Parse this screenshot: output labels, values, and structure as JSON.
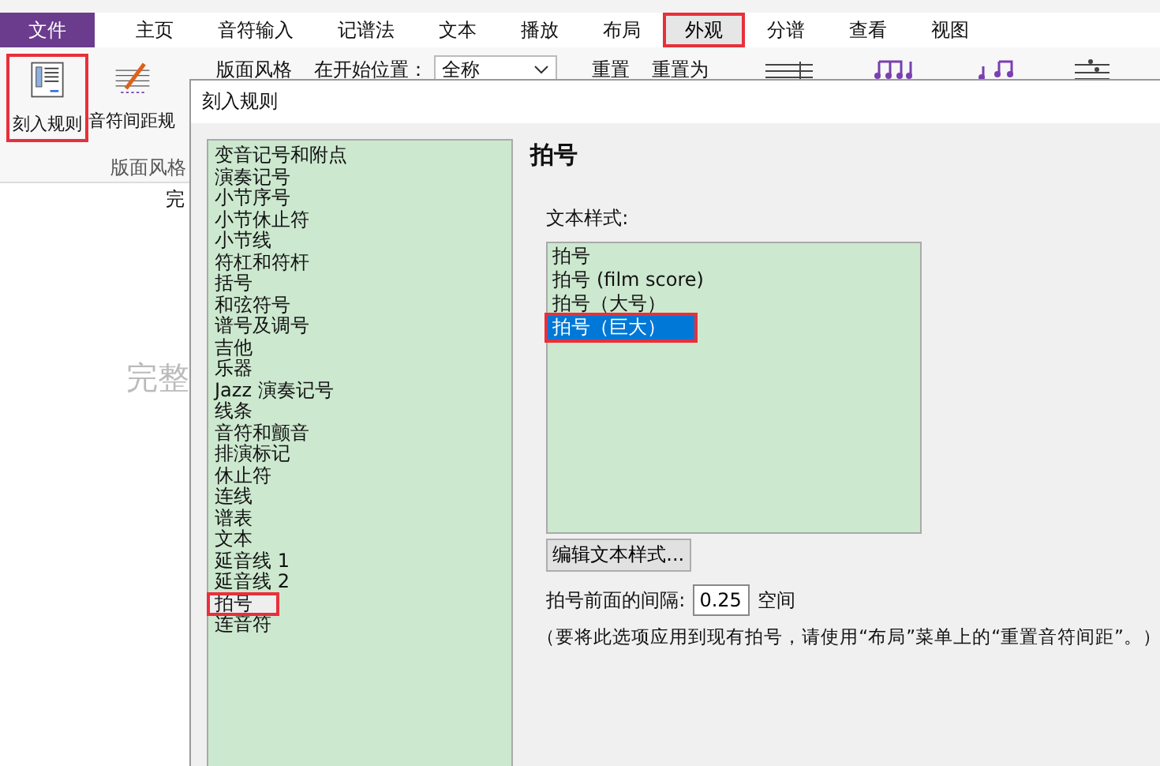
{
  "menu_tabs": [
    {
      "label": "文件",
      "kind": "file",
      "selected": false,
      "highlighted": false
    },
    {
      "label": "主页",
      "kind": "tab",
      "selected": false,
      "highlighted": false
    },
    {
      "label": "音符输入",
      "kind": "tab",
      "selected": false,
      "highlighted": false
    },
    {
      "label": "记谱法",
      "kind": "tab",
      "selected": false,
      "highlighted": false
    },
    {
      "label": "文本",
      "kind": "tab",
      "selected": false,
      "highlighted": false
    },
    {
      "label": "播放",
      "kind": "tab",
      "selected": false,
      "highlighted": false
    },
    {
      "label": "布局",
      "kind": "tab",
      "selected": false,
      "highlighted": false
    },
    {
      "label": "外观",
      "kind": "tab",
      "selected": true,
      "highlighted": true
    },
    {
      "label": "分谱",
      "kind": "tab",
      "selected": false,
      "highlighted": false
    },
    {
      "label": "查看",
      "kind": "tab",
      "selected": false,
      "highlighted": false
    },
    {
      "label": "视图",
      "kind": "tab",
      "selected": false,
      "highlighted": false
    }
  ],
  "ribbon": {
    "buttons": [
      {
        "label": "刻入规则",
        "highlighted": true
      },
      {
        "label": "音符间距规",
        "highlighted": false
      }
    ],
    "group_label": "版面风格",
    "style_label": "版面风格",
    "start_label": "在开始位置：",
    "start_value": "全称",
    "reset": "重置",
    "reset_to": "重置为"
  },
  "document": {
    "texts": [
      "完",
      "完整"
    ]
  },
  "dialog": {
    "title": "刻入规则",
    "categories": [
      {
        "label": "变音记号和附点",
        "selected": false,
        "highlighted": false
      },
      {
        "label": "演奏记号",
        "selected": false,
        "highlighted": false
      },
      {
        "label": "小节序号",
        "selected": false,
        "highlighted": false
      },
      {
        "label": "小节休止符",
        "selected": false,
        "highlighted": false
      },
      {
        "label": "小节线",
        "selected": false,
        "highlighted": false
      },
      {
        "label": "符杠和符杆",
        "selected": false,
        "highlighted": false
      },
      {
        "label": "括号",
        "selected": false,
        "highlighted": false
      },
      {
        "label": "和弦符号",
        "selected": false,
        "highlighted": false
      },
      {
        "label": "谱号及调号",
        "selected": false,
        "highlighted": false
      },
      {
        "label": "吉他",
        "selected": false,
        "highlighted": false
      },
      {
        "label": "乐器",
        "selected": false,
        "highlighted": false
      },
      {
        "label": "Jazz 演奏记号",
        "selected": false,
        "highlighted": false
      },
      {
        "label": "线条",
        "selected": false,
        "highlighted": false
      },
      {
        "label": "音符和颤音",
        "selected": false,
        "highlighted": false
      },
      {
        "label": "排演标记",
        "selected": false,
        "highlighted": false
      },
      {
        "label": "休止符",
        "selected": false,
        "highlighted": false
      },
      {
        "label": "连线",
        "selected": false,
        "highlighted": false
      },
      {
        "label": "谱表",
        "selected": false,
        "highlighted": false
      },
      {
        "label": "文本",
        "selected": false,
        "highlighted": false
      },
      {
        "label": "延音线 1",
        "selected": false,
        "highlighted": false
      },
      {
        "label": "延音线 2",
        "selected": false,
        "highlighted": false
      },
      {
        "label": "拍号",
        "selected": true,
        "highlighted": true
      },
      {
        "label": "连音符",
        "selected": false,
        "highlighted": false
      }
    ],
    "heading": "拍号",
    "text_style_label": "文本样式:",
    "text_styles": [
      {
        "label": "拍号",
        "selected": false,
        "highlighted": false
      },
      {
        "label": "拍号 (film score)",
        "selected": false,
        "highlighted": false
      },
      {
        "label": "拍号（大号）",
        "selected": false,
        "highlighted": false
      },
      {
        "label": "拍号（巨大）",
        "selected": true,
        "highlighted": true
      }
    ],
    "edit_button": "编辑文本样式...",
    "gap_label": "拍号前面的间隔:",
    "gap_value": "0.25",
    "gap_unit": "空间",
    "note": "（要将此选项应用到现有拍号，请使用“布局”菜单上的“重置音符间距”。）"
  }
}
